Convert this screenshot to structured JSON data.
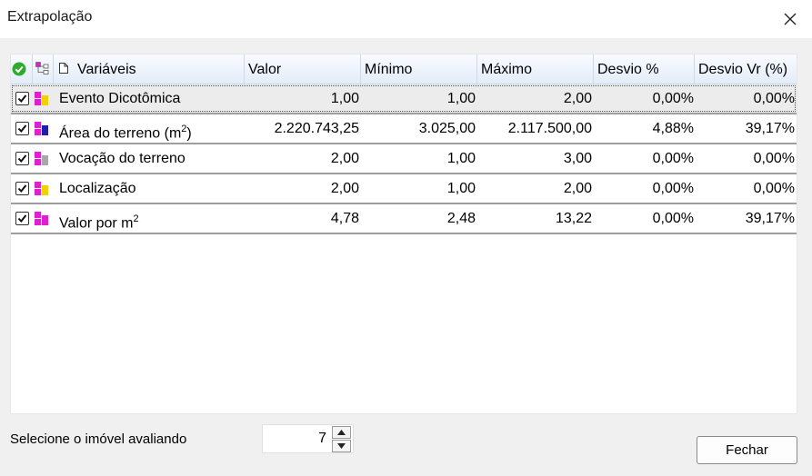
{
  "window": {
    "title": "Extrapolação"
  },
  "table": {
    "columns": {
      "variaveis": "Variáveis",
      "valor": "Valor",
      "minimo": "Mínimo",
      "maximo": "Máximo",
      "desvio_pct": "Desvio %",
      "desvio_vr": "Desvio Vr (%)"
    },
    "rows": [
      {
        "name": "Evento Dicotômica",
        "sup": "",
        "valor": "1,00",
        "minimo": "1,00",
        "maximo": "2,00",
        "desvio_pct": "0,00%",
        "desvio_vr": "0,00%",
        "checked": true,
        "selected": true,
        "icon": "yellow-variable-icon"
      },
      {
        "name": "Área do terreno (m",
        "sup": "2",
        "suffix": ")",
        "valor": "2.220.743,25",
        "minimo": "3.025,00",
        "maximo": "2.117.500,00",
        "desvio_pct": "4,88%",
        "desvio_vr": "39,17%",
        "checked": true,
        "selected": false,
        "icon": "blue-variable-icon"
      },
      {
        "name": "Vocação do terreno",
        "sup": "",
        "valor": "2,00",
        "minimo": "1,00",
        "maximo": "3,00",
        "desvio_pct": "0,00%",
        "desvio_vr": "0,00%",
        "checked": true,
        "selected": false,
        "icon": "gray-variable-icon"
      },
      {
        "name": "Localização",
        "sup": "",
        "valor": "2,00",
        "minimo": "1,00",
        "maximo": "2,00",
        "desvio_pct": "0,00%",
        "desvio_vr": "0,00%",
        "checked": true,
        "selected": false,
        "icon": "yellow-variable-icon"
      },
      {
        "name": "Valor por m",
        "sup": "2",
        "valor": "4,78",
        "minimo": "2,48",
        "maximo": "13,22",
        "desvio_pct": "0,00%",
        "desvio_vr": "39,17%",
        "checked": true,
        "selected": false,
        "icon": "magenta-variable-icon"
      }
    ]
  },
  "footer": {
    "select_label": "Selecione o imóvel avaliando",
    "imovel_value": "7",
    "close_label": "Fechar"
  },
  "colors": {
    "magenta": "#e020d0",
    "yellow": "#f2d100",
    "blue": "#1f1fa8",
    "gray": "#a8a8a8",
    "check_green": "#2eaa2e"
  }
}
